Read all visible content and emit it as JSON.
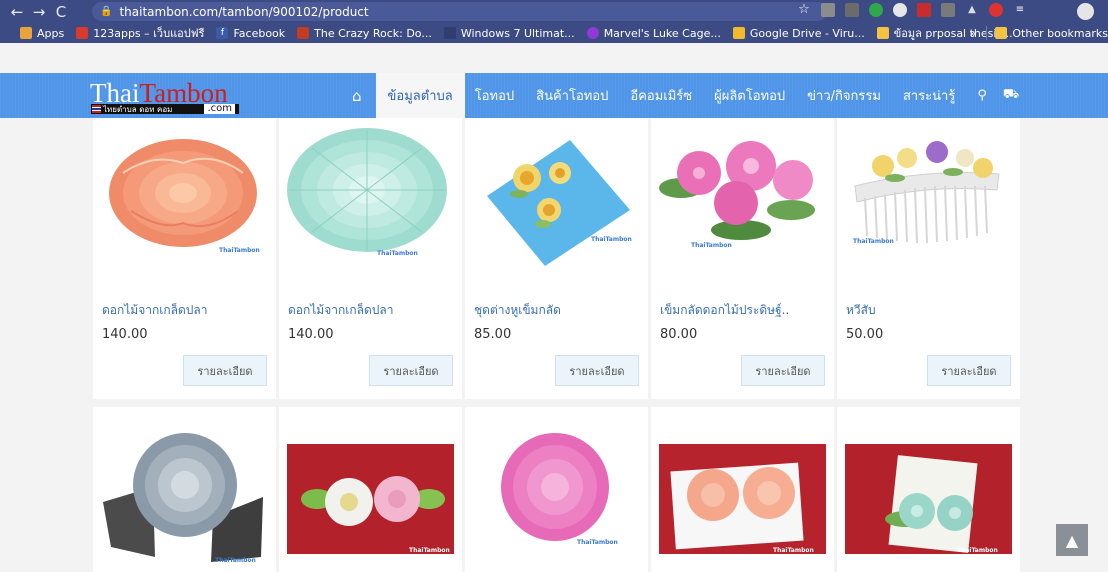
{
  "browser": {
    "url": "thaitambon.com/tambon/900102/product",
    "bookmarks": [
      {
        "label": "Apps",
        "icon": "apps-grid-icon",
        "color": "#e8a33d"
      },
      {
        "label": "123apps – เว็บแอปฟรี",
        "icon": "123apps-icon",
        "color": "#d83a2e"
      },
      {
        "label": "Facebook",
        "icon": "facebook-icon",
        "color": "#3b5ba8"
      },
      {
        "label": "The Crazy Rock: Do...",
        "icon": "crazy-rock-icon",
        "color": "#c23b22"
      },
      {
        "label": "Windows 7 Ultimat...",
        "icon": "windows-icon",
        "color": "#2f3e6e"
      },
      {
        "label": "Marvel's Luke Cage...",
        "icon": "marvel-icon",
        "color": "#8f3ad6"
      },
      {
        "label": "Google Drive - Viru...",
        "icon": "google-drive-icon",
        "color": "#f2b92a"
      },
      {
        "label": "ข้อมูล prposal thesis...",
        "icon": "folder-icon",
        "color": "#f5c342"
      }
    ],
    "more_bookmarks": "»",
    "other_bookmarks": "Other bookmarks"
  },
  "site": {
    "logo_part1": "Thai",
    "logo_part2": "Tambon",
    "logo_sub": "ไทยตำบล ดอท คอม",
    "logo_com": ".com",
    "menu": [
      {
        "label": "ข้อมูลตำบล",
        "active": true
      },
      {
        "label": "โอทอป",
        "active": false
      },
      {
        "label": "สินค้าโอทอป",
        "active": false
      },
      {
        "label": "อีคอมเมิร์ซ",
        "active": false
      },
      {
        "label": "ผู้ผลิตโอทอป",
        "active": false
      },
      {
        "label": "ข่าว/กิจกรรม",
        "active": false
      },
      {
        "label": "สาระน่ารู้",
        "active": false
      }
    ]
  },
  "products": [
    {
      "name": "ดอกไม้จากเกล็ดปลา",
      "price": "140.00",
      "button": "รายละเอียด"
    },
    {
      "name": "ดอกไม้จากเกล็ดปลา",
      "price": "140.00",
      "button": "รายละเอียด"
    },
    {
      "name": "ชุดต่างหูเข็มกลัด",
      "price": "85.00",
      "button": "รายละเอียด"
    },
    {
      "name": "เข็มกลัดดอกไม้ประดิษฐ์..",
      "price": "80.00",
      "button": "รายละเอียด"
    },
    {
      "name": "หวีสับ",
      "price": "50.00",
      "button": "รายละเอียด"
    }
  ],
  "watermark": "ThaiTambon",
  "colors": {
    "browser_bar": "#3c4b84",
    "site_header": "#4f95e8",
    "link": "#3b6fb3",
    "button_bg": "#eaf4fa"
  }
}
